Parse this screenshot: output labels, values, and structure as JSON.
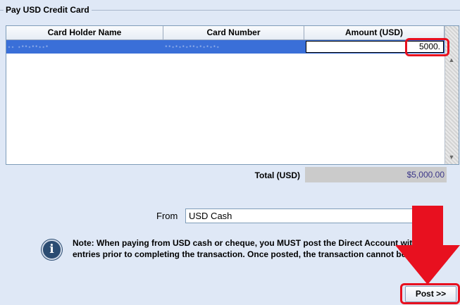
{
  "group": {
    "title": "Pay USD Credit Card"
  },
  "table": {
    "columns": [
      "Card Holder Name",
      "Card Number",
      "Amount (USD)"
    ],
    "rows": [
      {
        "holder": "·· ·‧‧·‧‧··‧",
        "number": "‧‧·‧·‧·‧‧·‧·‧·‧·",
        "amount": "5000."
      }
    ]
  },
  "total": {
    "label": "Total (USD)",
    "value": "$5,000.00"
  },
  "from": {
    "label": "From",
    "value": "USD Cash"
  },
  "note": {
    "line1": "Note: When paying from USD cash or cheque, you MUST post the Direct Account with",
    "line2": "entries prior to completing the transaction. Once posted, the transaction cannot be"
  },
  "buttons": {
    "post": "Post >>"
  },
  "colors": {
    "background": "#dfe8f6",
    "selected_row": "#3a6fd8",
    "total_value_text": "#3b3689",
    "highlight": "#e8101f"
  },
  "icons": {
    "info": "info-icon",
    "scroll_up": "scroll-up-icon",
    "scroll_down": "scroll-down-icon"
  }
}
